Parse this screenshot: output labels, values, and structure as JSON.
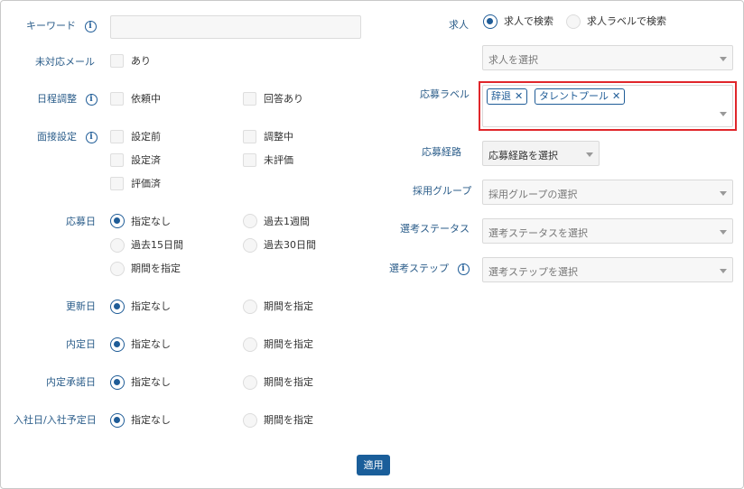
{
  "left": {
    "keyword_label": "キーワード",
    "keyword_value": "",
    "unresponded_mail_label": "未対応メール",
    "unresponded_mail_option": "あり",
    "schedule_label": "日程調整",
    "schedule_options": [
      "依頼中",
      "回答あり"
    ],
    "interview_label": "面接設定",
    "interview_options": [
      "設定前",
      "調整中",
      "設定済",
      "未評価",
      "評価済"
    ],
    "apply_date_label": "応募日",
    "apply_date_options": [
      "指定なし",
      "過去1週間",
      "過去15日間",
      "過去30日間",
      "期間を指定"
    ],
    "updated_label": "更新日",
    "offer_label": "内定日",
    "offer_accept_label": "内定承諾日",
    "join_label": "入社日/入社予定日",
    "none_option": "指定なし",
    "period_option": "期間を指定"
  },
  "right": {
    "job_label": "求人",
    "job_search_options": [
      "求人で検索",
      "求人ラベルで検索"
    ],
    "job_select_placeholder": "求人を選択",
    "apply_label_label": "応募ラベル",
    "apply_label_tags": [
      "辞退",
      "タレントプール"
    ],
    "route_label": "応募経路",
    "route_placeholder": "応募経路を選択",
    "group_label": "採用グループ",
    "group_placeholder": "採用グループの選択",
    "status_label": "選考ステータス",
    "status_placeholder": "選考ステータスを選択",
    "step_label": "選考ステップ",
    "step_placeholder": "選考ステップを選択"
  },
  "apply_button": "適用",
  "colors": {
    "accent": "#1f5c97",
    "label": "#2b5d8a",
    "highlight": "#e0262b"
  },
  "icons": {
    "info": "info-icon",
    "remove": "close-icon",
    "dropdown": "chevron-down-icon"
  }
}
